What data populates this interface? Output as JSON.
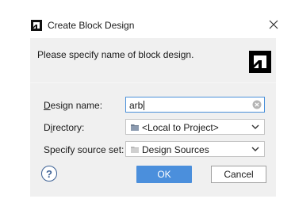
{
  "window": {
    "title": "Create Block Design",
    "close_glyph": "×",
    "logo_icon": "xilinx-vivado-logo-icon"
  },
  "header": {
    "message": "Please specify name of block design."
  },
  "form": {
    "design_name": {
      "label_mnemonic": "D",
      "label_rest": "esign name:",
      "value": "arb"
    },
    "directory": {
      "label_before": "D",
      "label_mnemonic": "i",
      "label_after": "rectory:",
      "value": "<Local to Project>"
    },
    "source_set": {
      "label": "Specify source set:",
      "value": "Design Sources"
    }
  },
  "buttons": {
    "help": "?",
    "ok": "OK",
    "cancel": "Cancel"
  },
  "colors": {
    "accent": "#4b8fdc",
    "panel_bg": "#f0f0f0",
    "help_color": "#3a5f94"
  }
}
